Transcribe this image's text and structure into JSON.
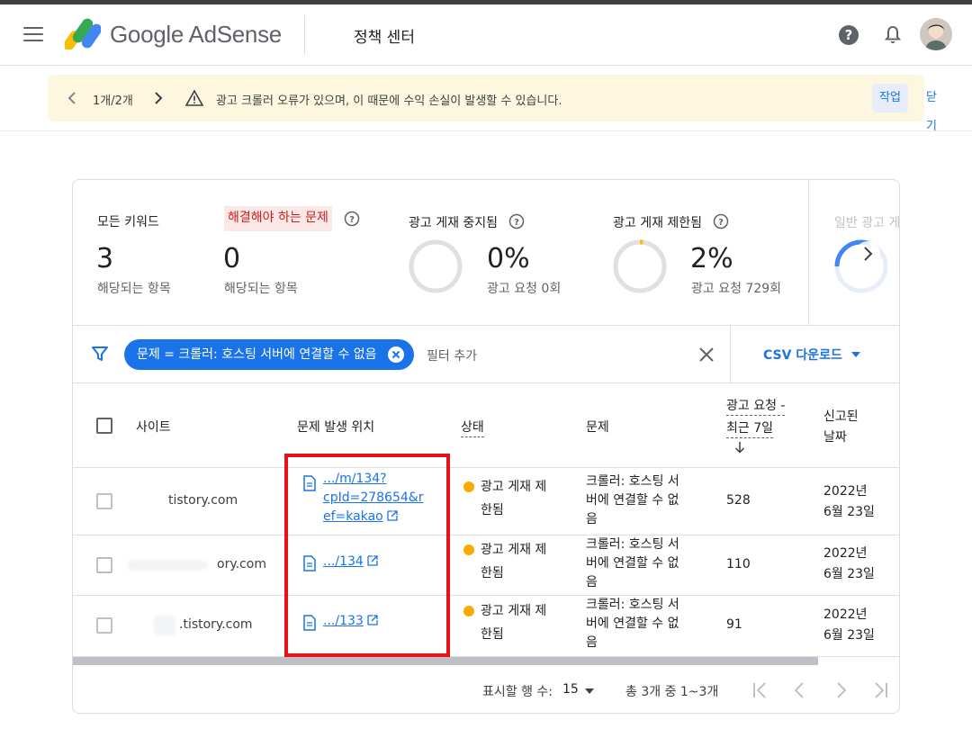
{
  "header": {
    "brand": "Google AdSense",
    "section": "정책 센터"
  },
  "banner": {
    "pager": "1개/2개",
    "message": "광고 크롤러 오류가 있으며, 이 때문에 수익 손실이 발생할 수 있습니다.",
    "action_label": "작업",
    "close_label": "닫기"
  },
  "stats": {
    "all_keywords": {
      "title": "모든 키워드",
      "value": "3",
      "sub": "해당되는 항목"
    },
    "must_fix": {
      "title": "해결해야 하는 문제",
      "value": "0",
      "sub": "해당되는 항목"
    },
    "suspended": {
      "title": "광고 게재 중지됨",
      "value": "0%",
      "sub": "광고 요청 0회",
      "fraction": 0
    },
    "limited": {
      "title": "광고 게재 제한됨",
      "value": "2%",
      "sub": "광고 요청 729회",
      "fraction": 0.02
    },
    "general": {
      "title": "일반 광고 게",
      "fraction": 0.3
    }
  },
  "filter": {
    "chip_label": "문제 = 크롤러: 호스팅 서버에 연결할 수 없음",
    "add_filter": "필터 추가",
    "csv_label": "CSV 다운로드"
  },
  "table": {
    "columns": {
      "site": "사이트",
      "location": "문제 발생 위치",
      "status": "상태",
      "issue": "문제",
      "requests_line1": "광고 요청 -",
      "requests_line2": "최근 7일",
      "reported_line1": "신고된",
      "reported_line2": "날짜"
    },
    "rows": [
      {
        "site": "tistory.com",
        "location_lines": [
          ".../m/134?",
          "cpId=278654&r",
          "ef=kakao"
        ],
        "status_lines": [
          "광고 게재 제",
          "한됨"
        ],
        "issue_lines": [
          "크롤러: 호스팅 서",
          "버에 연결할 수 없",
          "음"
        ],
        "requests": "528",
        "date_lines": [
          "2022년",
          "6월 23일"
        ]
      },
      {
        "site": "ory.com",
        "location_lines": [
          ".../134"
        ],
        "status_lines": [
          "광고 게재 제",
          "한됨"
        ],
        "issue_lines": [
          "크롤러: 호스팅 서",
          "버에 연결할 수 없",
          "음"
        ],
        "requests": "110",
        "date_lines": [
          "2022년",
          "6월 23일"
        ]
      },
      {
        "site": ".tistory.com",
        "location_lines": [
          ".../133"
        ],
        "status_lines": [
          "광고 게재 제",
          "한됨"
        ],
        "issue_lines": [
          "크롤러: 호스팅 서",
          "버에 연결할 수 없",
          "음"
        ],
        "requests": "91",
        "date_lines": [
          "2022년",
          "6월 23일"
        ]
      }
    ]
  },
  "pagination": {
    "rows_label": "표시할 행 수:",
    "rows_value": "15",
    "range": "총 3개 중 1~3개"
  },
  "colors": {
    "accent": "#1a73e8",
    "banner_bg": "#fef7e0",
    "flag_bg": "#fce8e6",
    "flag_text": "#c5221f",
    "status_dot": "#f9ab00",
    "highlight": "#e8121d"
  }
}
